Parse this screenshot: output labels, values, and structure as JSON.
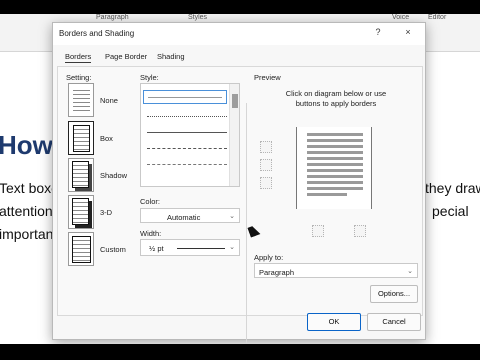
{
  "ribbon": {
    "paragraph_label": "Paragraph",
    "styles_label": "Styles",
    "voice_label": "Voice",
    "editor_label": "Editor"
  },
  "document": {
    "heading": "How t",
    "lines": [
      {
        "left": "Text boxe",
        "right": "they draw"
      },
      {
        "left": "attention to",
        "right": "pecial"
      },
      {
        "left": "importance",
        "right": ""
      }
    ]
  },
  "dialog": {
    "title": "Borders and Shading",
    "help_label": "?",
    "close_label": "×",
    "tabs": [
      "Borders",
      "Page Border",
      "Shading"
    ],
    "active_tab": "Borders",
    "setting": {
      "label": "Setting:",
      "options": [
        "None",
        "Box",
        "Shadow",
        "3-D",
        "Custom"
      ]
    },
    "style": {
      "label": "Style:"
    },
    "color": {
      "label": "Color:",
      "value": "Automatic"
    },
    "width": {
      "label": "Width:",
      "value": "½ pt"
    },
    "preview": {
      "label": "Preview",
      "instruction_line1": "Click on diagram below or use",
      "instruction_line2": "buttons to apply borders"
    },
    "apply_to": {
      "label": "Apply to:",
      "value": "Paragraph"
    },
    "options_button": "Options...",
    "ok_button": "OK",
    "cancel_button": "Cancel"
  }
}
